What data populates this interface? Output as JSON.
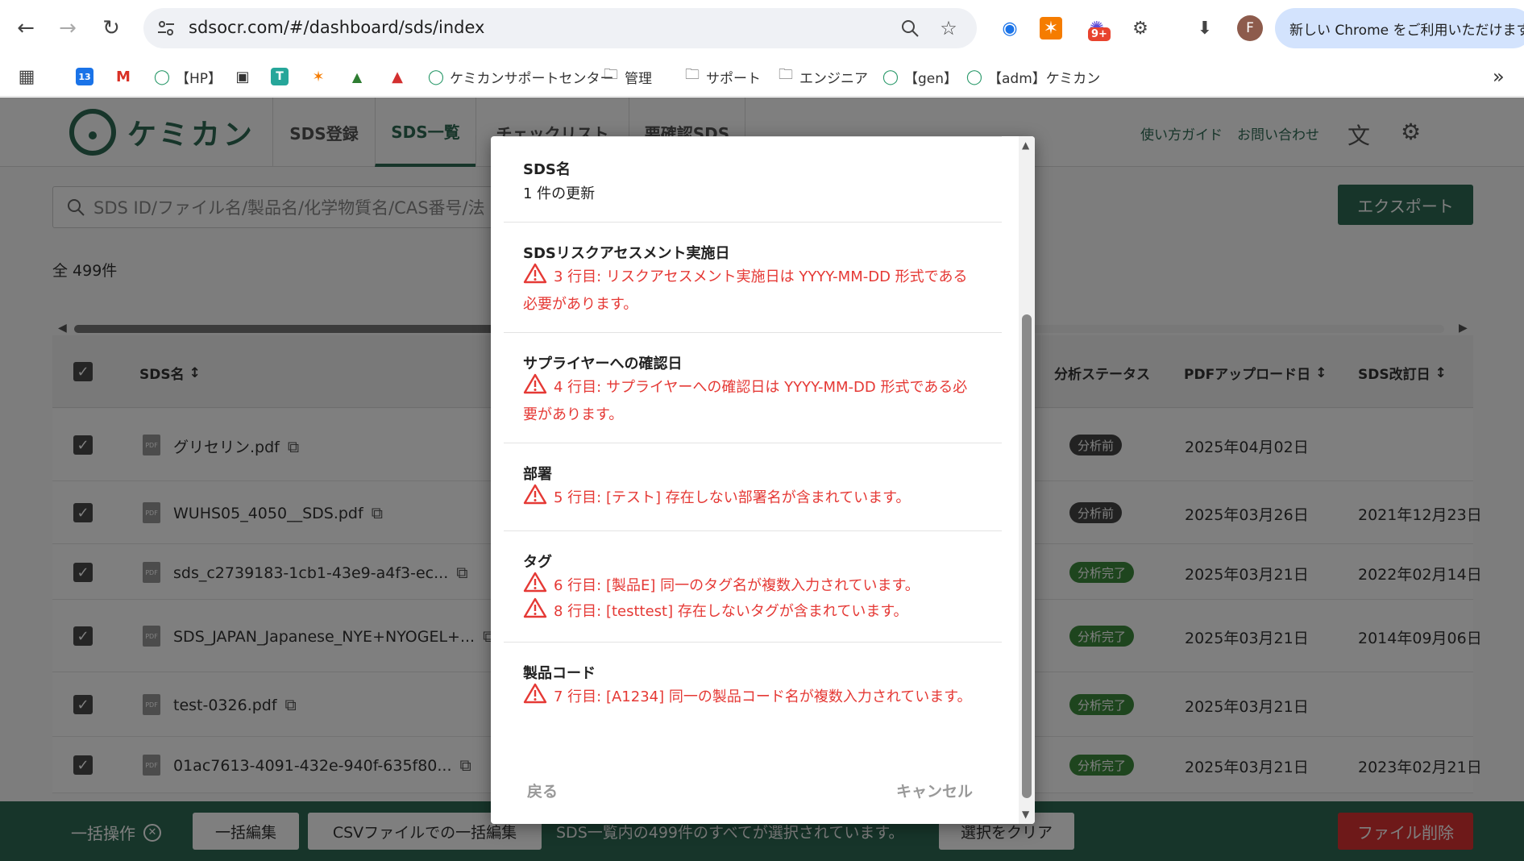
{
  "browser": {
    "url": "sdsocr.com/#/dashboard/sds/index",
    "promo": "新しい Chrome をご利用いただけます",
    "profile_initial": "F",
    "ext_badge": "9+",
    "bookmarks": [
      {
        "label": "",
        "icon": "apps-grid-icon"
      },
      {
        "label": "",
        "icon": "calendar-icon",
        "glyph": "13"
      },
      {
        "label": "",
        "icon": "gmail-icon",
        "glyph": "M"
      },
      {
        "label": "【HP】",
        "icon": "chemikan-icon"
      },
      {
        "label": "",
        "icon": "shield-icon"
      },
      {
        "label": "",
        "icon": "t-icon",
        "glyph": "T"
      },
      {
        "label": "",
        "icon": "hubspot-icon"
      },
      {
        "label": "",
        "icon": "zendesk-icon"
      },
      {
        "label": "",
        "icon": "mountain-icon"
      },
      {
        "label": "ケミカンサポートセンター",
        "icon": "chemikan-icon"
      },
      {
        "label": "管理",
        "icon": "folder-icon"
      },
      {
        "label": "サポート",
        "icon": "folder-icon"
      },
      {
        "label": "エンジニア",
        "icon": "folder-icon"
      },
      {
        "label": "【gen】",
        "icon": "chemikan-icon"
      },
      {
        "label": "【adm】ケミカン",
        "icon": "chemikan-icon"
      }
    ]
  },
  "app": {
    "logo": "ケミカン",
    "tabs": [
      "SDS登録",
      "SDS一覧",
      "チェックリスト",
      "要確認SDS"
    ],
    "guide": "使い方ガイド",
    "contact": "お問い合わせ",
    "search_placeholder": "SDS ID/ファイル名/製品名/化学物質名/CAS番号/法",
    "export": "エクスポート",
    "total": "全 499件",
    "columns": {
      "name": "SDS名",
      "status": "分析ステータス",
      "upload": "PDFアップロード日",
      "revised": "SDS改訂日"
    },
    "rows": [
      {
        "name": "グリセリン.pdf",
        "status": "分析前",
        "upload": "2025年04月02日",
        "revised": ""
      },
      {
        "name": "WUHS05_4050__SDS.pdf",
        "status": "分析前",
        "upload": "2025年03月26日",
        "revised": "2021年12月23日"
      },
      {
        "name": "sds_c2739183-1cb1-43e9-a4f3-ec...",
        "status": "分析完了",
        "upload": "2025年03月21日",
        "revised": "2022年02月14日"
      },
      {
        "name": "SDS_JAPAN_Japanese_NYE+NYOGEL+...",
        "status": "分析完了",
        "upload": "2025年03月21日",
        "revised": "2014年09月06日"
      },
      {
        "name": "test-0326.pdf",
        "status": "分析完了",
        "upload": "2025年03月21日",
        "revised": ""
      },
      {
        "name": "01ac7613-4091-432e-940f-635f80...",
        "status": "分析完了",
        "upload": "2025年03月21日",
        "revised": "2023年02月21日"
      }
    ],
    "bulk": {
      "label": "一括操作",
      "edit": "一括編集",
      "csv_edit": "CSVファイルでの一括編集",
      "message": "SDS一覧内の499件のすべてが選択されています。",
      "clear": "選択をクリア",
      "delete": "ファイル削除"
    }
  },
  "modal": {
    "sections": [
      {
        "title": "SDS名",
        "text": "1 件の更新",
        "errors": []
      },
      {
        "title": "SDSリスクアセスメント実施日",
        "errors": [
          "3 行目: リスクアセスメント実施日は YYYY-MM-DD 形式である必要があります。"
        ]
      },
      {
        "title": "サプライヤーへの確認日",
        "errors": [
          "4 行目: サプライヤーへの確認日は YYYY-MM-DD 形式である必要があります。"
        ]
      },
      {
        "title": "部署",
        "errors": [
          "5 行目: [テスト] 存在しない部署名が含まれています。"
        ]
      },
      {
        "title": "タグ",
        "errors": [
          "6 行目: [製品E] 同一のタグ名が複数入力されています。",
          "8 行目: [testtest] 存在しないタグが含まれています。"
        ]
      },
      {
        "title": "製品コード",
        "errors": [
          "7 行目: [A1234] 同一の製品コード名が複数入力されています。"
        ]
      }
    ],
    "back": "戻る",
    "cancel": "キャンセル"
  },
  "colors": {
    "brand": "#2e6b54",
    "error": "#e53935",
    "danger": "#dd3333"
  }
}
